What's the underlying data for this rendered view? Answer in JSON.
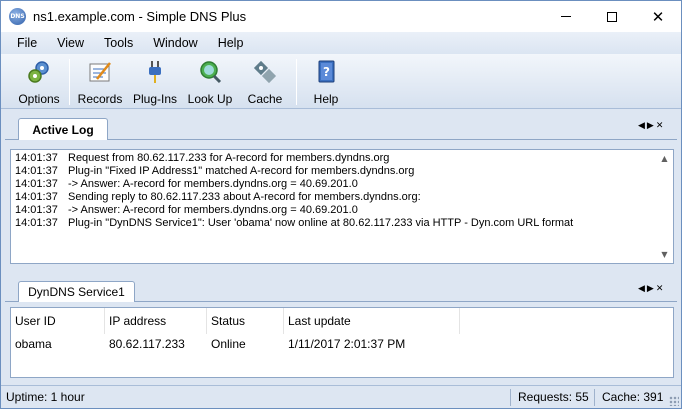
{
  "window": {
    "title": "ns1.example.com - Simple DNS Plus",
    "icon_label": "DNS",
    "minimize_glyph": "—",
    "maximize_glyph": "☐",
    "close_glyph": "✕"
  },
  "menu": [
    "File",
    "View",
    "Tools",
    "Window",
    "Help"
  ],
  "toolbar": {
    "buttons": [
      {
        "label": "Options",
        "icon": "gears-icon"
      },
      {
        "label": "Records",
        "icon": "records-icon"
      },
      {
        "label": "Plug-Ins",
        "icon": "plug-icon"
      },
      {
        "label": "Look Up",
        "icon": "globe-magnifier-icon"
      },
      {
        "label": "Cache",
        "icon": "cache-icon"
      },
      {
        "label": "Help",
        "icon": "help-book-icon"
      }
    ]
  },
  "active_log": {
    "tab_label": "Active Log",
    "lines": [
      {
        "time": "14:01:37",
        "text": "Request from 80.62.117.233 for A-record for members.dyndns.org"
      },
      {
        "time": "14:01:37",
        "text": "Plug-in \"Fixed IP Address1\" matched A-record for members.dyndns.org"
      },
      {
        "time": "14:01:37",
        "text": "-> Answer: A-record for members.dyndns.org = 40.69.201.0"
      },
      {
        "time": "14:01:37",
        "text": "Sending reply to 80.62.117.233 about A-record for members.dyndns.org:"
      },
      {
        "time": "14:01:37",
        "text": "-> Answer: A-record for members.dyndns.org = 40.69.201.0"
      },
      {
        "time": "14:01:37",
        "text": "Plug-in \"DynDNS Service1\": User 'obama' now online at 80.62.117.233 via HTTP - Dyn.com URL format"
      }
    ]
  },
  "dyndns": {
    "tab_label": "DynDNS Service1",
    "columns": [
      "User ID",
      "IP address",
      "Status",
      "Last update"
    ],
    "rows": [
      [
        "obama",
        "80.62.117.233",
        "Online",
        "1/11/2017 2:01:37 PM"
      ]
    ]
  },
  "tab_nav": {
    "prev": "◀",
    "next": "▶",
    "close": "✕"
  },
  "status": {
    "uptime": "Uptime: 1 hour",
    "requests": "Requests: 55",
    "cache": "Cache: 391"
  },
  "colors": {
    "frame": "#dde6f2",
    "border": "#8ea6c6",
    "accent": "#2e5ea8"
  }
}
